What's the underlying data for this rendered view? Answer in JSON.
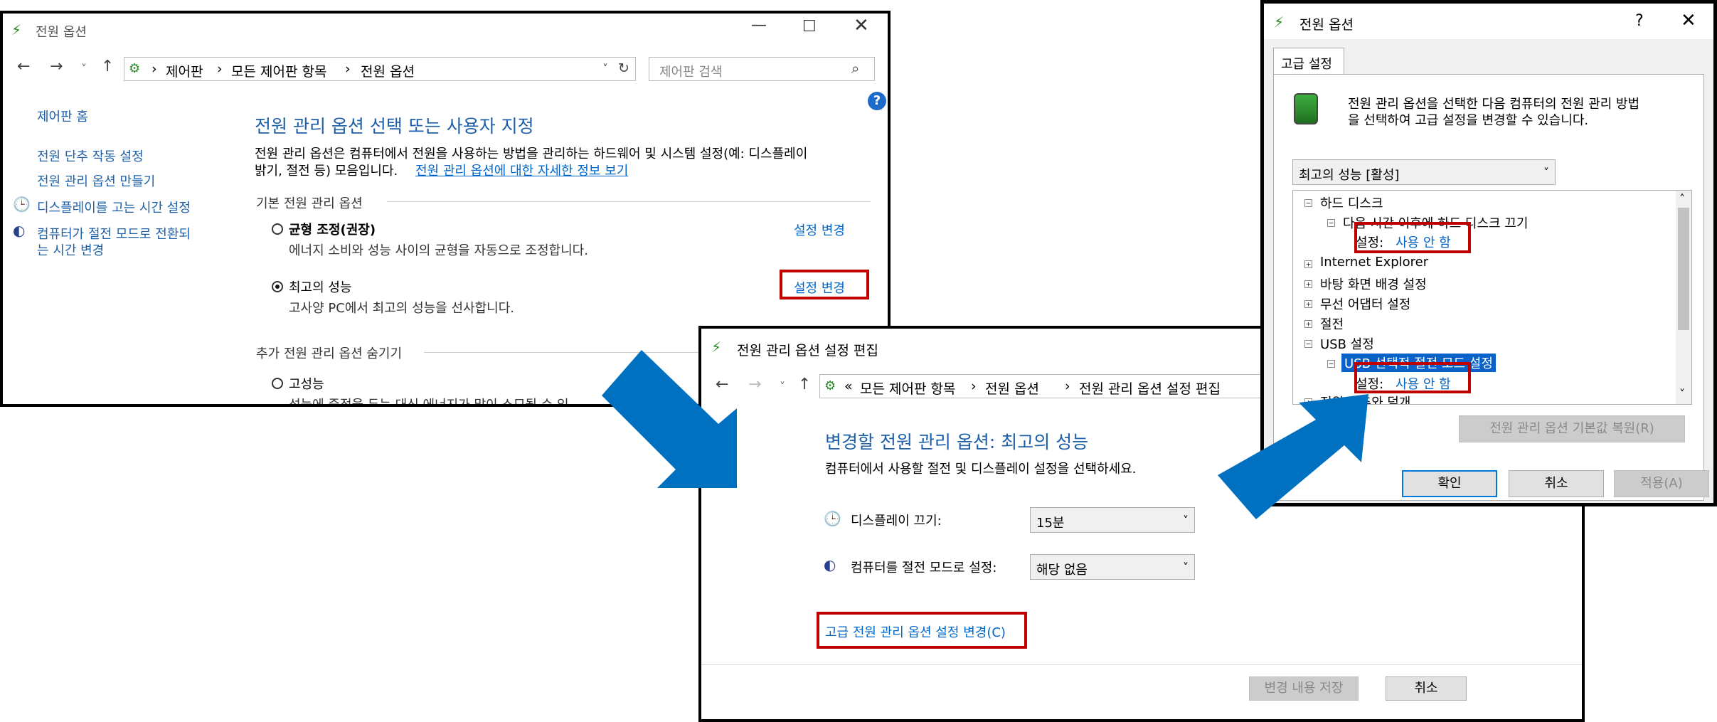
{
  "win1": {
    "title": "전원 옵션",
    "breadcrumb": [
      "제어판",
      "모든 제어판 항목",
      "전원 옵션"
    ],
    "search_placeholder": "제어판 검색",
    "sidebar": {
      "home": "제어판 홈",
      "items": [
        "전원 단추 작동 설정",
        "전원 관리 옵션 만들기",
        "디스플레이를 고는 시간 설정",
        "컴퓨터가 절전 모드로 전환되",
        "는 시간 변경"
      ]
    },
    "heading": "전원 관리 옵션 선택 또는 사용자 지정",
    "desc_line1": "전원 관리 옵션은 컴퓨터에서 전원을 사용하는 방법을 관리하는 하드웨어 및 시스템 설정(예: 디스플레이",
    "desc_line2": "밝기, 절전 등) 모음입니다.",
    "desc_link": "전원 관리 옵션에 대한 자세한 정보 보기",
    "section_basic": "기본 전원 관리 옵션",
    "plans": [
      {
        "name": "균형 조정(권장)",
        "desc": "에너지 소비와 성능 사이의 균형을 자동으로 조정합니다.",
        "action": "설정 변경"
      },
      {
        "name": "최고의 성능",
        "desc": "고사양 PC에서 최고의 성능을 선사합니다.",
        "action": "설정 변경"
      }
    ],
    "section_extra": "추가 전원 관리 옵션 숨기기",
    "plan3_name": "고성능",
    "plan3_desc": "성능에 중점을 두는 대신 에너지가 많이 소모될 수 있"
  },
  "win2": {
    "title": "전원 관리 옵션 설정 편집",
    "breadcrumb_prefix": "«",
    "breadcrumb": [
      "모든 제어판 항목",
      "전원 옵션",
      "전원 관리 옵션 설정 편집"
    ],
    "heading": "변경할 전원 관리 옵션: 최고의 성능",
    "subtext": "컴퓨터에서 사용할 절전 및 디스플레이 설정을 선택하세요.",
    "display_label": "디스플레이 끄기:",
    "display_value": "15분",
    "sleep_label": "컴퓨터를 절전 모드로 설정:",
    "sleep_value": "해당 없음",
    "advanced_link": "고급 전원 관리 옵션 설정 변경(C)",
    "save_button": "변경 내용 저장",
    "cancel_button": "취소"
  },
  "win3": {
    "title": "전원 옵션",
    "help_glyph": "?",
    "tab": "고급 설정",
    "intro_line1": "전원 관리 옵션을 선택한 다음 컴퓨터의 전원 관리 방법",
    "intro_line2": "을 선택하여 고급 설정을 변경할 수 있습니다.",
    "plan_select": "최고의 성능 [활성]",
    "tree": {
      "hard_disk": "하드 디스크",
      "hd_sub": "다음 시간 이후에 하드 디스크 끄기",
      "setting_prefix": "설정:",
      "setting_value": "사용 안 함",
      "ie": "Internet Explorer",
      "desktop": "바탕 화면 배경 설정",
      "wireless": "무선 어댑터 설정",
      "sleep": "절전",
      "usb": "USB 설정",
      "usb_sub": "USB 선택적 절전 모드 설정",
      "partial": "전원 단추와 덮개"
    },
    "restore_button": "전원 관리 옵션 기본값 복원(R)",
    "ok_button": "확인",
    "cancel_button": "취소",
    "apply_button": "적용(A)"
  },
  "colors": {
    "arrow": "#0070c0",
    "highlight_box": "#c00000",
    "link": "#0066cc",
    "heading": "#1d5fa8"
  }
}
